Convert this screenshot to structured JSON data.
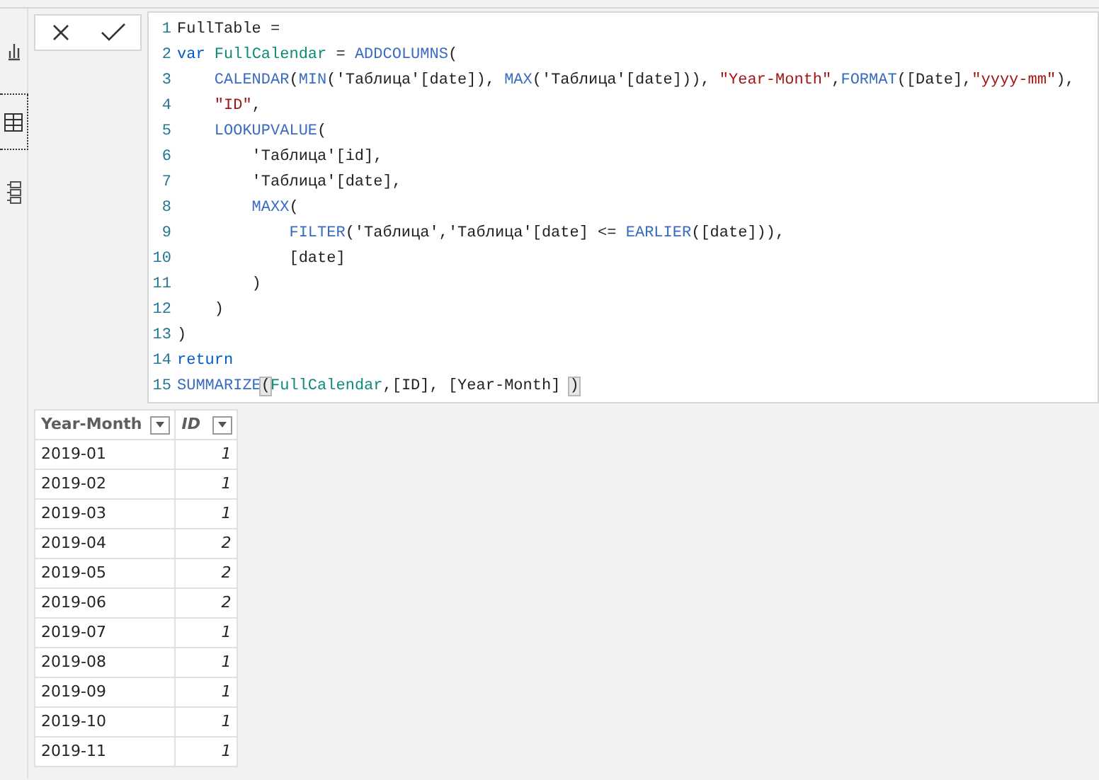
{
  "sidebar": {
    "items": [
      {
        "kind": "report",
        "selected": false
      },
      {
        "kind": "data",
        "selected": true
      },
      {
        "kind": "model",
        "selected": false
      }
    ]
  },
  "formula_bar": {
    "lines": [
      {
        "number": "1",
        "tokens": [
          {
            "kind": "plain",
            "text": "FullTable ="
          }
        ]
      },
      {
        "number": "2",
        "tokens": [
          {
            "kind": "keyword",
            "text": "var"
          },
          {
            "kind": "variable",
            "text": " FullCalendar"
          },
          {
            "kind": "plain",
            "text": " = "
          },
          {
            "kind": "function",
            "text": "ADDCOLUMNS"
          },
          {
            "kind": "plain",
            "text": "("
          }
        ]
      },
      {
        "number": "3",
        "tokens": [
          {
            "kind": "function",
            "text": "    CALENDAR"
          },
          {
            "kind": "plain",
            "text": "("
          },
          {
            "kind": "function",
            "text": "MIN"
          },
          {
            "kind": "plain",
            "text": "('Таблица'[date]), "
          },
          {
            "kind": "function",
            "text": "MAX"
          },
          {
            "kind": "plain",
            "text": "('Таблица'[date])), "
          },
          {
            "kind": "string",
            "text": "\"Year-Month\""
          },
          {
            "kind": "plain",
            "text": ","
          },
          {
            "kind": "function",
            "text": "FORMAT"
          },
          {
            "kind": "plain",
            "text": "([Date],"
          },
          {
            "kind": "string",
            "text": "\"yyyy-mm\""
          },
          {
            "kind": "plain",
            "text": "),"
          }
        ]
      },
      {
        "number": "4",
        "tokens": [
          {
            "kind": "string",
            "text": "    \"ID\""
          },
          {
            "kind": "plain",
            "text": ","
          }
        ]
      },
      {
        "number": "5",
        "tokens": [
          {
            "kind": "function",
            "text": "    LOOKUPVALUE"
          },
          {
            "kind": "plain",
            "text": "("
          }
        ]
      },
      {
        "number": "6",
        "tokens": [
          {
            "kind": "plain",
            "text": "        'Таблица'[id],"
          }
        ]
      },
      {
        "number": "7",
        "tokens": [
          {
            "kind": "plain",
            "text": "        'Таблица'[date],"
          }
        ]
      },
      {
        "number": "8",
        "tokens": [
          {
            "kind": "function",
            "text": "        MAXX"
          },
          {
            "kind": "plain",
            "text": "("
          }
        ]
      },
      {
        "number": "9",
        "tokens": [
          {
            "kind": "function",
            "text": "            FILTER"
          },
          {
            "kind": "plain",
            "text": "('Таблица','Таблица'[date] <= "
          },
          {
            "kind": "function",
            "text": "EARLIER"
          },
          {
            "kind": "plain",
            "text": "([date])),"
          }
        ]
      },
      {
        "number": "10",
        "tokens": [
          {
            "kind": "plain",
            "text": "            [date]"
          }
        ]
      },
      {
        "number": "11",
        "tokens": [
          {
            "kind": "plain",
            "text": "        )"
          }
        ]
      },
      {
        "number": "12",
        "tokens": [
          {
            "kind": "plain",
            "text": "    )"
          }
        ]
      },
      {
        "number": "13",
        "tokens": [
          {
            "kind": "plain",
            "text": ")"
          }
        ]
      },
      {
        "number": "14",
        "tokens": [
          {
            "kind": "keyword",
            "text": "return"
          }
        ]
      },
      {
        "number": "15",
        "tokens": [
          {
            "kind": "function",
            "text": "SUMMARIZE"
          },
          {
            "kind": "bracket-match",
            "text": "("
          },
          {
            "kind": "variable",
            "text": "FullCalendar"
          },
          {
            "kind": "plain",
            "text": ",[ID], [Year-Month] "
          },
          {
            "kind": "bracket-match",
            "text": ")"
          }
        ]
      }
    ]
  },
  "table": {
    "columns": [
      {
        "label": "Year-Month"
      },
      {
        "label": "ID"
      }
    ],
    "rows": [
      [
        "2019-01",
        "1"
      ],
      [
        "2019-02",
        "1"
      ],
      [
        "2019-03",
        "1"
      ],
      [
        "2019-04",
        "2"
      ],
      [
        "2019-05",
        "2"
      ],
      [
        "2019-06",
        "2"
      ],
      [
        "2019-07",
        "1"
      ],
      [
        "2019-08",
        "1"
      ],
      [
        "2019-09",
        "1"
      ],
      [
        "2019-10",
        "1"
      ],
      [
        "2019-11",
        "1"
      ]
    ]
  }
}
